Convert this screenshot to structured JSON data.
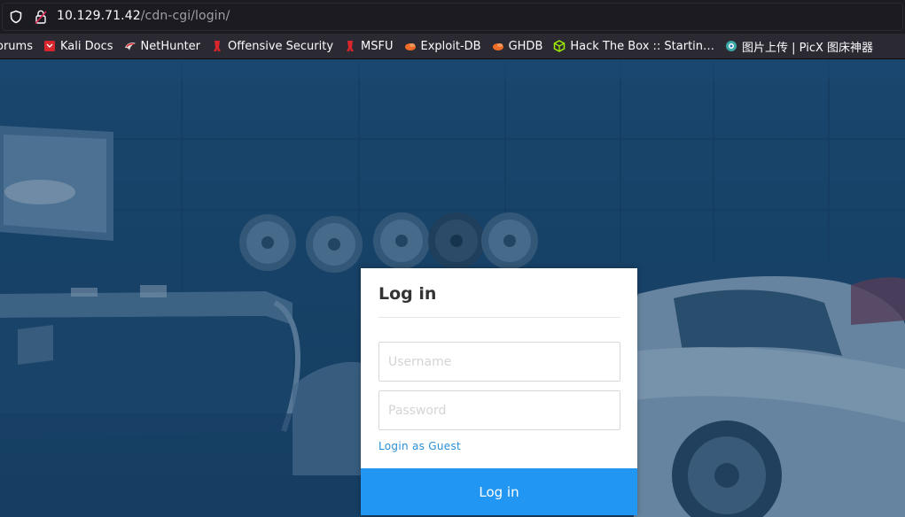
{
  "browser": {
    "url_host": "10.129.71.42",
    "url_path": "/cdn-cgi/login/",
    "bookmarks": [
      {
        "label": "orums",
        "icon": "forum-icon"
      },
      {
        "label": "Kali Docs",
        "icon": "kali-docs-icon"
      },
      {
        "label": "NetHunter",
        "icon": "nethunter-icon"
      },
      {
        "label": "Offensive Security",
        "icon": "offsec-icon"
      },
      {
        "label": "MSFU",
        "icon": "msfu-icon"
      },
      {
        "label": "Exploit-DB",
        "icon": "exploitdb-icon"
      },
      {
        "label": "GHDB",
        "icon": "ghdb-icon"
      },
      {
        "label": "Hack The Box :: Startin…",
        "icon": "htb-cube-icon"
      },
      {
        "label": "图片上传 | PicX 图床神器",
        "icon": "picx-icon"
      }
    ]
  },
  "login": {
    "title": "Log in",
    "username_placeholder": "Username",
    "password_placeholder": "Password",
    "guest_link": "Login as Guest",
    "submit_label": "Log in"
  },
  "colors": {
    "accent": "#2196f3",
    "link": "#2b8fd6",
    "background_tint": "#1f4a70"
  }
}
